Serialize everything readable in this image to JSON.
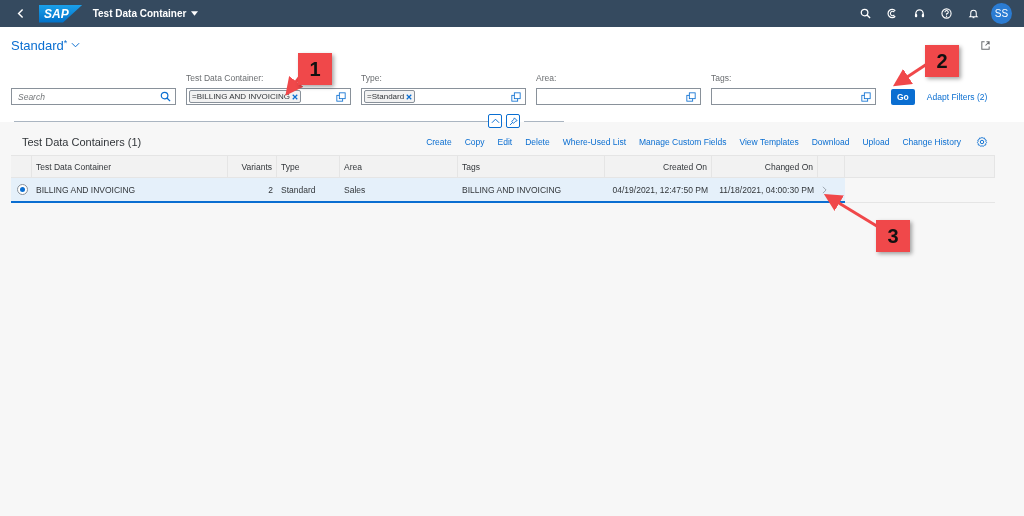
{
  "shell": {
    "logo": "SAP",
    "title": "Test Data Container",
    "avatar": "SS"
  },
  "variant": {
    "name": "Standard",
    "modified_mark": "*"
  },
  "filters": {
    "search": {
      "placeholder": "Search"
    },
    "fields": [
      {
        "label": "Test Data Container:",
        "token": "=BILLING AND INVOICING"
      },
      {
        "label": "Type:",
        "token": "=Standard"
      },
      {
        "label": "Area:"
      },
      {
        "label": "Tags:"
      }
    ],
    "go": "Go",
    "adapt": "Adapt Filters (2)"
  },
  "table": {
    "title": "Test Data Containers (1)",
    "actions": [
      "Create",
      "Copy",
      "Edit",
      "Delete",
      "Where-Used List",
      "Manage Custom Fields",
      "View Templates",
      "Download",
      "Upload",
      "Change History"
    ],
    "columns": [
      {
        "label": "Test Data Container"
      },
      {
        "label": "Variants"
      },
      {
        "label": "Type"
      },
      {
        "label": "Area"
      },
      {
        "label": "Tags"
      },
      {
        "label": "Created On"
      },
      {
        "label": "Changed On"
      }
    ],
    "rows": [
      {
        "selected": true,
        "cells": [
          "BILLING AND INVOICING",
          "2",
          "Standard",
          "Sales",
          "BILLING AND INVOICING",
          "04/19/2021, 12:47:50 PM",
          "11/18/2021, 04:00:30 PM"
        ]
      }
    ]
  },
  "annotations": [
    {
      "label": "1"
    },
    {
      "label": "2"
    },
    {
      "label": "3"
    }
  ]
}
